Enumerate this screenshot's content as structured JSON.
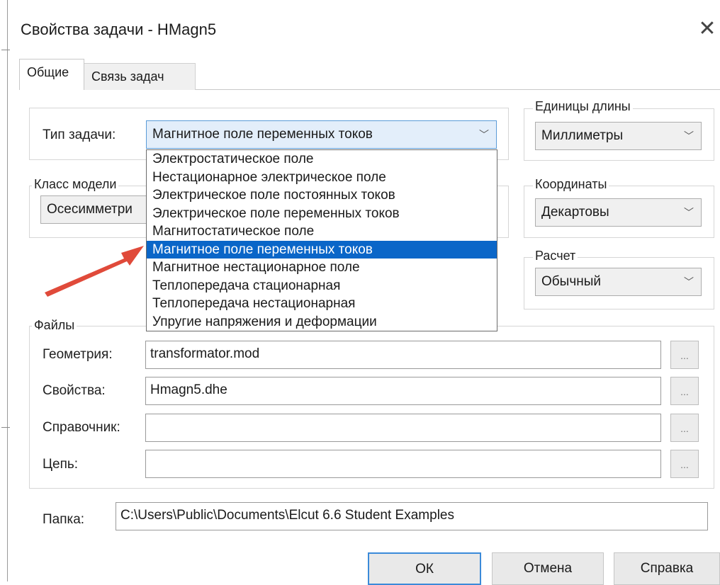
{
  "window": {
    "title": "Свойства задачи - HMagn5",
    "close_glyph": "✕"
  },
  "tabs": [
    {
      "label": "Общие"
    },
    {
      "label": "Связь задач"
    }
  ],
  "task_type": {
    "label": "Тип задачи:",
    "value": "Магнитное поле переменных токов",
    "options": [
      "Электростатическое поле",
      "Нестационарное электрическое поле",
      "Электрическое поле постоянных токов",
      "Электрическое поле переменных токов",
      "Магнитостатическое поле",
      "Магнитное поле переменных токов",
      "Магнитное нестационарное поле",
      "Теплопередача стационарная",
      "Теплопередача нестационарная",
      "Упругие напряжения и деформации"
    ],
    "selected_index": 5
  },
  "model_class": {
    "label": "Класс модели",
    "value": "Осесимметри"
  },
  "length_units": {
    "label": "Единицы длины",
    "value": "Миллиметры"
  },
  "coordinates": {
    "label": "Координаты",
    "value": "Декартовы"
  },
  "calculation": {
    "label": "Расчет",
    "value": "Обычный"
  },
  "files": {
    "label": "Файлы",
    "browse_label": "...",
    "rows": [
      {
        "label": "Геометрия:",
        "value": "transformator.mod"
      },
      {
        "label": "Свойства:",
        "value": "Hmagn5.dhe"
      },
      {
        "label": "Справочник:",
        "value": ""
      },
      {
        "label": "Цепь:",
        "value": ""
      }
    ]
  },
  "folder": {
    "label": "Папка:",
    "value": "C:\\Users\\Public\\Documents\\Elcut 6.6 Student Examples"
  },
  "buttons": {
    "ok": "ОК",
    "cancel": "Отмена",
    "help": "Справка"
  },
  "colors": {
    "selection": "#0a66c8",
    "arrow": "#e04a3a",
    "focus_border": "#3b8ad9"
  },
  "icons": {
    "combo_arrow": "chevron-down-icon",
    "close": "close-icon",
    "annotation": "red-arrow-icon"
  }
}
